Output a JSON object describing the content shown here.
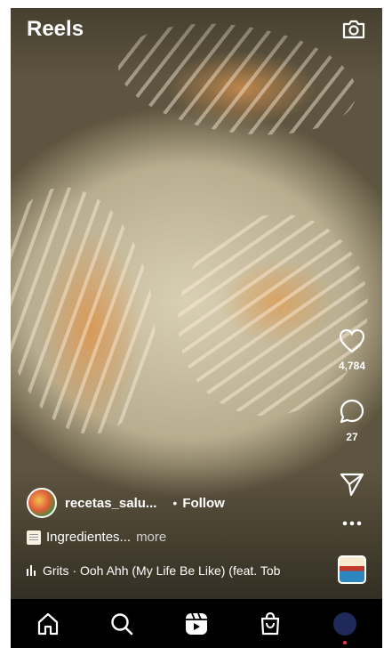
{
  "header": {
    "title": "Reels",
    "camera_icon": "camera-icon"
  },
  "actions": {
    "like_count": "4,784",
    "comment_count": "27"
  },
  "post": {
    "username": "recetas_salu...",
    "separator": "•",
    "follow_label": "Follow",
    "caption": "Ingredientes...",
    "caption_more": "more",
    "audio": "Grits · Ooh Ahh (My Life Be Like) (feat. Tob"
  },
  "nav": {
    "items": [
      "home-icon",
      "search-icon",
      "reels-icon",
      "shop-icon",
      "profile-avatar"
    ]
  },
  "colors": {
    "background": "#000000",
    "text": "#ffffff",
    "notification_dot": "#ff3040"
  }
}
